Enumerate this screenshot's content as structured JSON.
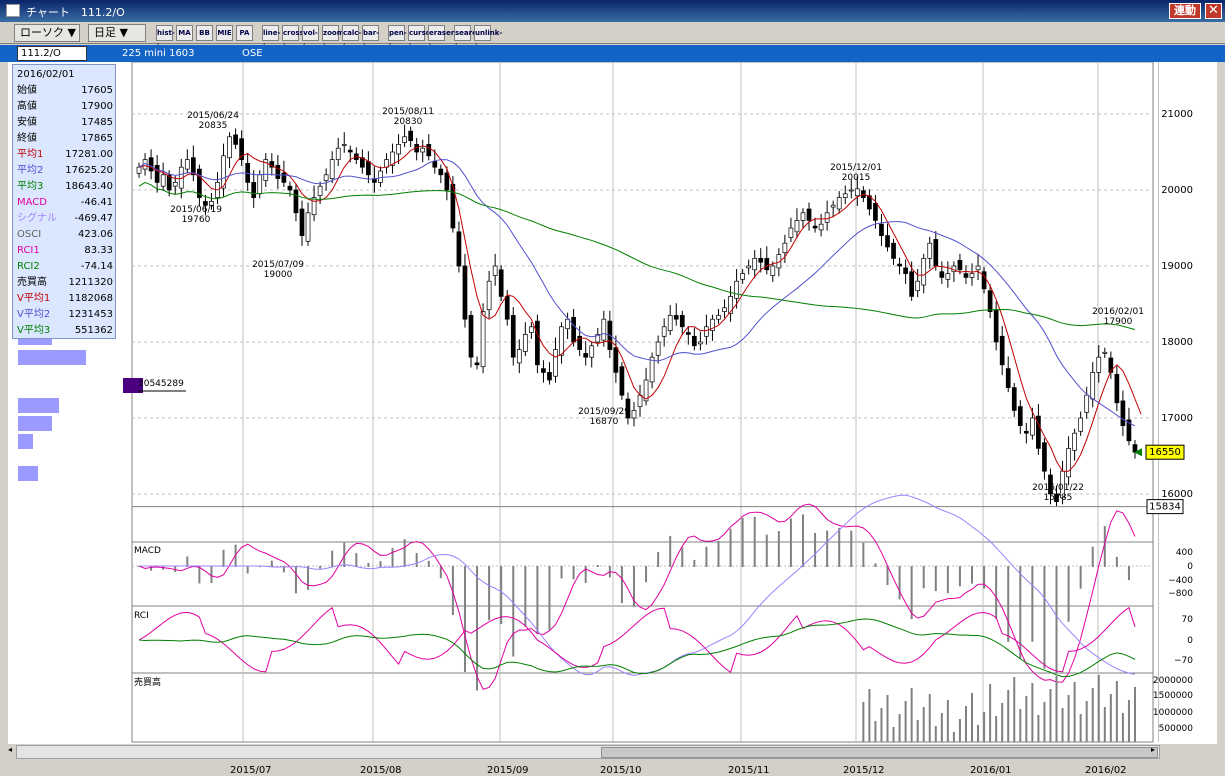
{
  "window": {
    "title": "チャート　111.2/O",
    "rendo_label": "連動",
    "close_label": "✕"
  },
  "toolbar": {
    "chart_type": "ローソク ▼",
    "period": "日足 ▼",
    "tools": [
      "hist-icon",
      "MA",
      "BB",
      "MIE",
      "PA",
      "line-icon",
      "cross-icon",
      "vol-icon",
      "zoom-icon",
      "calc-icon",
      "bar-icon",
      "pen-icon",
      "cursor-icon",
      "eraser-icon",
      "search-icon",
      "unlink-icon"
    ]
  },
  "info": {
    "code": "111.2/O",
    "name": "225 mini 1603",
    "market": "OSE"
  },
  "panel": {
    "date": "2016/02/01",
    "rows": [
      {
        "label": "始値",
        "value": "17605",
        "color": "#000000"
      },
      {
        "label": "高値",
        "value": "17900",
        "color": "#000000"
      },
      {
        "label": "安値",
        "value": "17485",
        "color": "#000000"
      },
      {
        "label": "終値",
        "value": "17865",
        "color": "#000000"
      },
      {
        "label": "平均1",
        "value": "17281.00",
        "color": "#c00000"
      },
      {
        "label": "平均2",
        "value": "17625.20",
        "color": "#5050d0"
      },
      {
        "label": "平均3",
        "value": "18643.40",
        "color": "#008000"
      },
      {
        "label": "MACD",
        "value": "-46.41",
        "color": "#e000a0"
      },
      {
        "label": "シグナル",
        "value": "-469.47",
        "color": "#a080ff"
      },
      {
        "label": "OSCI",
        "value": "423.06",
        "color": "#606060"
      },
      {
        "label": "RCI1",
        "value": "83.33",
        "color": "#e000a0"
      },
      {
        "label": "RCI2",
        "value": "-74.14",
        "color": "#008000"
      },
      {
        "label": "売買高",
        "value": "1211320",
        "color": "#000000"
      },
      {
        "label": "V平均1",
        "value": "1182068",
        "color": "#c00000"
      },
      {
        "label": "V平均2",
        "value": "1231453",
        "color": "#5050d0"
      },
      {
        "label": "V平均3",
        "value": "551362",
        "color": "#008000"
      }
    ]
  },
  "volume_profile_label": "10545289",
  "price_axis": {
    "ticks": [
      "21000",
      "20000",
      "19000",
      "18000",
      "17000",
      "16000"
    ],
    "current": "16550",
    "low_marker": "15834"
  },
  "annotations": [
    {
      "date": "2015/06/24",
      "value": "20835"
    },
    {
      "date": "2015/06/19",
      "value": "19760"
    },
    {
      "date": "2015/07/09",
      "value": "19000"
    },
    {
      "date": "2015/08/11",
      "value": "20830"
    },
    {
      "date": "2015/09/29",
      "value": "16870"
    },
    {
      "date": "2015/12/01",
      "value": "20015"
    },
    {
      "date": "2016/01/22",
      "value": "15785"
    },
    {
      "date": "2016/02/01",
      "value": "17900"
    }
  ],
  "macd": {
    "label": "MACD",
    "ticks": [
      "400",
      "0",
      "−400",
      "−800"
    ]
  },
  "rci": {
    "label": "RCI",
    "ticks": [
      "70",
      "0",
      "−70"
    ]
  },
  "volume": {
    "label": "売買高",
    "ticks": [
      "2000000",
      "1500000",
      "1000000",
      "500000"
    ]
  },
  "dates": [
    "2015/07",
    "2015/08",
    "2015/09",
    "2015/10",
    "2015/11",
    "2015/12",
    "2016/01",
    "2016/02"
  ],
  "chart_data": {
    "type": "candlestick",
    "ylim": [
      15500,
      21500
    ],
    "colors": {
      "up": "#ffffff",
      "down": "#000000",
      "ma1": "#c00000",
      "ma2": "#5050d0",
      "ma3": "#008000"
    },
    "close_series": [
      20300,
      20400,
      20250,
      20100,
      20200,
      20000,
      20100,
      20300,
      20400,
      20200,
      19900,
      19800,
      19850,
      20100,
      20450,
      20700,
      20600,
      20400,
      20100,
      19900,
      20200,
      20400,
      20300,
      20150,
      20100,
      20000,
      19700,
      19400,
      19700,
      19900,
      20050,
      20200,
      20400,
      20550,
      20600,
      20500,
      20400,
      20300,
      20200,
      20100,
      20250,
      20400,
      20500,
      20600,
      20700,
      20650,
      20500,
      20550,
      20450,
      20300,
      20200,
      20000,
      19500,
      19000,
      18300,
      17800,
      17700,
      18400,
      18800,
      19000,
      18600,
      18300,
      17800,
      17900,
      18100,
      18200,
      17700,
      17600,
      17500,
      17900,
      18200,
      18300,
      18000,
      17900,
      17800,
      17950,
      18100,
      18300,
      17900,
      17600,
      17300,
      17000,
      17100,
      17300,
      17500,
      17800,
      18000,
      18200,
      18350,
      18300,
      18200,
      18100,
      17950,
      18000,
      18200,
      18300,
      18350,
      18450,
      18600,
      18800,
      18900,
      19000,
      19100,
      19050,
      18950,
      19000,
      19150,
      19300,
      19500,
      19600,
      19700,
      19600,
      19500,
      19550,
      19700,
      19800,
      19900,
      19950,
      20000,
      20015,
      19900,
      19750,
      19600,
      19400,
      19250,
      19100,
      19000,
      18900,
      18600,
      18800,
      19100,
      19300,
      19000,
      18850,
      18900,
      19000,
      18950,
      18850,
      18900,
      19000,
      18700,
      18400,
      18000,
      17700,
      17400,
      17100,
      16900,
      16800,
      17000,
      16600,
      16300,
      16000,
      15900,
      16300,
      16600,
      16800,
      17000,
      17300,
      17600,
      17800,
      17865,
      17600,
      17200,
      16900,
      16700,
      16550
    ],
    "ma1_series": [
      20300,
      20320,
      20300,
      20250,
      20230,
      20180,
      20150,
      20150,
      20200,
      20220,
      20180,
      20100,
      20020,
      20000,
      20050,
      20200,
      20350,
      20450,
      20480,
      20420,
      20380,
      20360,
      20320,
      20280,
      20250,
      20180,
      20080,
      19950,
      19880,
      19850,
      19860,
      19900,
      20000,
      20150,
      20300,
      20400,
      20440,
      20420,
      20380,
      20320,
      20290,
      20300,
      20340,
      20380,
      20440,
      20520,
      20560,
      20580,
      20560,
      20500,
      20400,
      20280,
      20050,
      19750,
      19350,
      18950,
      18600,
      18350,
      18300,
      18350,
      18500,
      18620,
      18600,
      18520,
      18400,
      18300,
      18100,
      17950,
      17850,
      17800,
      17840,
      17920,
      18000,
      18050,
      18050,
      18000,
      17980,
      18000,
      18020,
      17950,
      17800,
      17600,
      17400,
      17300,
      17250,
      17300,
      17400,
      17550,
      17750,
      17950,
      18100,
      18200,
      18200,
      18150,
      18150,
      18180,
      18220,
      18300,
      18400,
      18500,
      18630,
      18750,
      18860,
      18950,
      19000,
      19030,
      19050,
      19120,
      19240,
      19380,
      19500,
      19580,
      19620,
      19620,
      19620,
      19650,
      19700,
      19760,
      19840,
      19910,
      19940,
      19920,
      19850,
      19730,
      19580,
      19430,
      19280,
      19130,
      18970,
      18880,
      18880,
      18940,
      19000,
      18990,
      18980,
      18950,
      18920,
      18930,
      18920,
      18930,
      18870,
      18740,
      18560,
      18340,
      18080,
      17800,
      17520,
      17260,
      17080,
      16920,
      16760,
      16620,
      16430,
      16300,
      16300,
      16380,
      16520,
      16720,
      16950,
      17200,
      17420,
      17620,
      17700,
      17620,
      17450,
      17250,
      17050
    ]
  }
}
